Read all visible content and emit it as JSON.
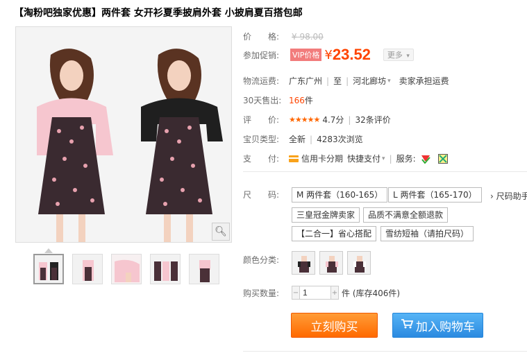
{
  "title": "【淘粉吧独家优惠】两件套 女开衫夏季披肩外套 小披肩夏百搭包邮",
  "gallery": {
    "zoom_icon": "magnifier-icon",
    "thumbnail_count": 5
  },
  "price": {
    "label": "价　　格:",
    "original": "¥ 98.00"
  },
  "promo": {
    "label": "参加促销:",
    "tag": "VIP价格",
    "currency": "¥",
    "value": "23.52",
    "more": "更多"
  },
  "shipping": {
    "label": "物流运费:",
    "from": "广东广州",
    "to_prefix": "至",
    "to": "河北廊坊",
    "fee": "卖家承担运费"
  },
  "sales": {
    "label": "30天售出:",
    "count": "166",
    "unit": "件"
  },
  "rating": {
    "label": "评　　价:",
    "stars": "★★★★★",
    "score": "4.7分",
    "reviews": "32条评价"
  },
  "type": {
    "label": "宝贝类型:",
    "condition": "全新",
    "views": "4283次浏览"
  },
  "payment": {
    "label": "支　　付:",
    "credit": "信用卡分期",
    "quick": "快捷支付",
    "service_label": "服务:"
  },
  "size": {
    "label": "尺　　码:",
    "options": [
      "M 两件套（160-165）",
      "L 两件套（165-170）",
      "三皇冠金牌卖家",
      "品质不满意全额退款",
      "【二合一】省心搭配",
      "雪纺短袖（请拍尺码）"
    ],
    "helper": "› 尺码助手"
  },
  "color": {
    "label": "颜色分类:",
    "swatch_count": 3
  },
  "quantity": {
    "label": "购买数量:",
    "value": "1",
    "stock": "件 (库存406件)"
  },
  "buttons": {
    "buy": "立刻购买",
    "cart": "加入购物车"
  },
  "colors": {
    "accent": "#ff4400",
    "buy_button": "#ff7a12",
    "cart_button": "#3b9ff0",
    "vip_tag": "#f27c7c"
  }
}
